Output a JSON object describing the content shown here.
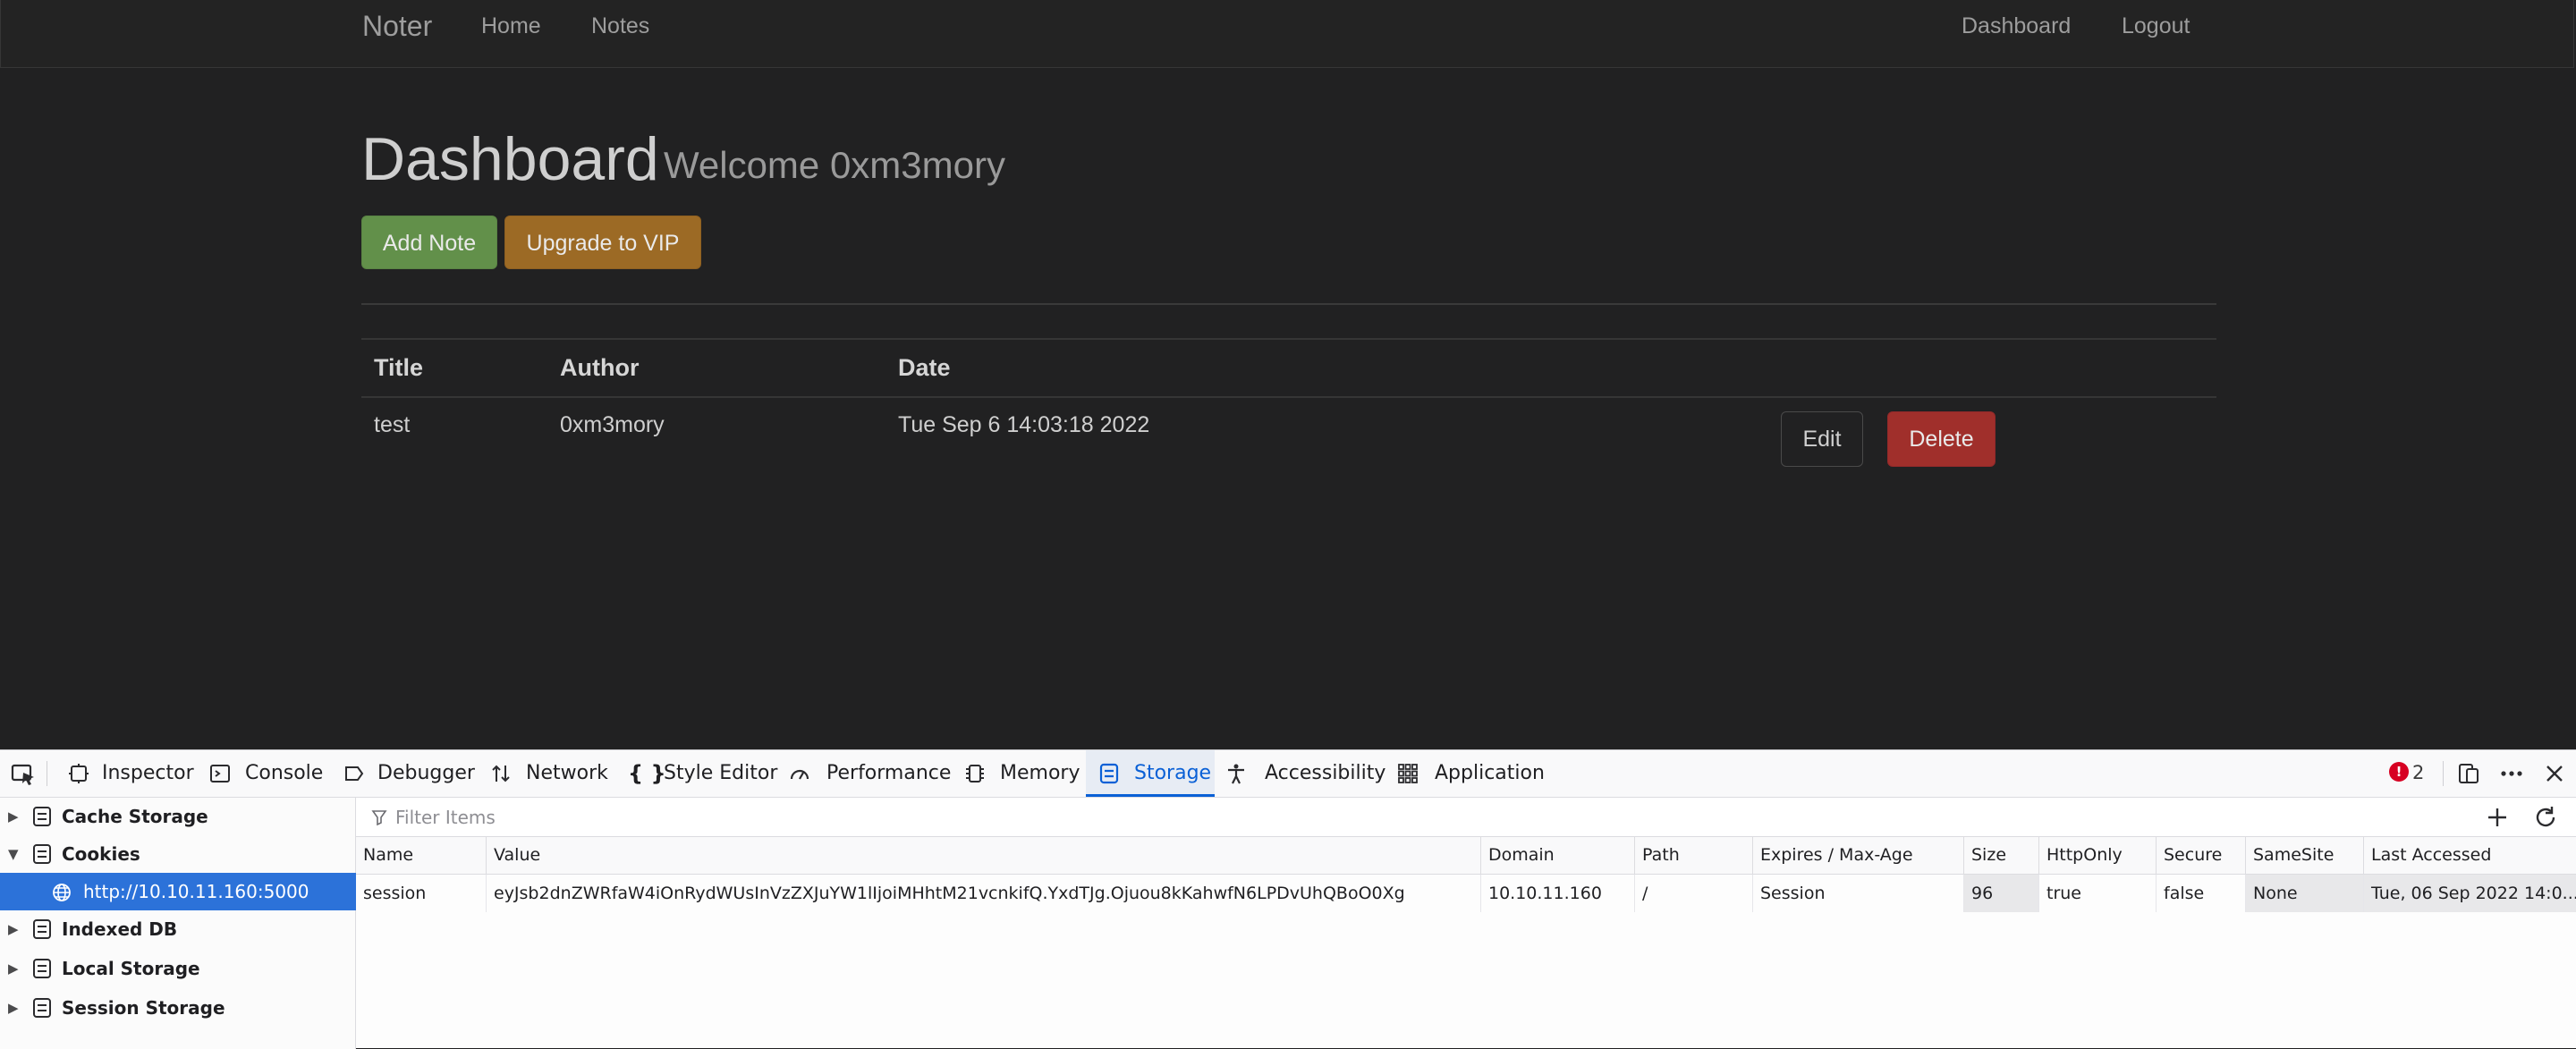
{
  "navbar": {
    "brand": "Noter",
    "links": [
      "Home",
      "Notes"
    ],
    "right_links": [
      "Dashboard",
      "Logout"
    ]
  },
  "main": {
    "title": "Dashboard",
    "subtitle": "Welcome 0xm3mory",
    "add_note_label": "Add Note",
    "upgrade_label": "Upgrade to VIP",
    "table": {
      "headers": [
        "Title",
        "Author",
        "Date"
      ],
      "rows": [
        {
          "title": "test",
          "author": "0xm3mory",
          "date": "Tue Sep 6 14:03:18 2022",
          "edit_label": "Edit",
          "delete_label": "Delete"
        }
      ]
    }
  },
  "devtools": {
    "tabs": [
      "Inspector",
      "Console",
      "Debugger",
      "Network",
      "Style Editor",
      "Performance",
      "Memory",
      "Storage",
      "Accessibility",
      "Application"
    ],
    "active_tab": "Storage",
    "error_count": "2",
    "error_badge": "!",
    "sidebar": {
      "cache_storage": "Cache Storage",
      "cookies": "Cookies",
      "cookie_host": "http://10.10.11.160:5000",
      "indexed_db": "Indexed DB",
      "local_storage": "Local Storage",
      "session_storage": "Session Storage"
    },
    "filter": {
      "placeholder": "Filter Items"
    },
    "cookie_table": {
      "headers": [
        "Name",
        "Value",
        "Domain",
        "Path",
        "Expires / Max-Age",
        "Size",
        "HttpOnly",
        "Secure",
        "SameSite",
        "Last Accessed"
      ],
      "rows": [
        {
          "name": "session",
          "value": "eyJsb2dnZWRfaW4iOnRydWUsInVzZXJuYW1lIjoiMHhtM21vcnkifQ.YxdTJg.Ojuou8kKahwfN6LPDvUhQBoO0Xg",
          "domain": "10.10.11.160",
          "path": "/",
          "expires": "Session",
          "size": "96",
          "httponly": "true",
          "secure": "false",
          "samesite": "None",
          "last_accessed": "Tue, 06 Sep 2022 14:0..."
        }
      ]
    }
  }
}
